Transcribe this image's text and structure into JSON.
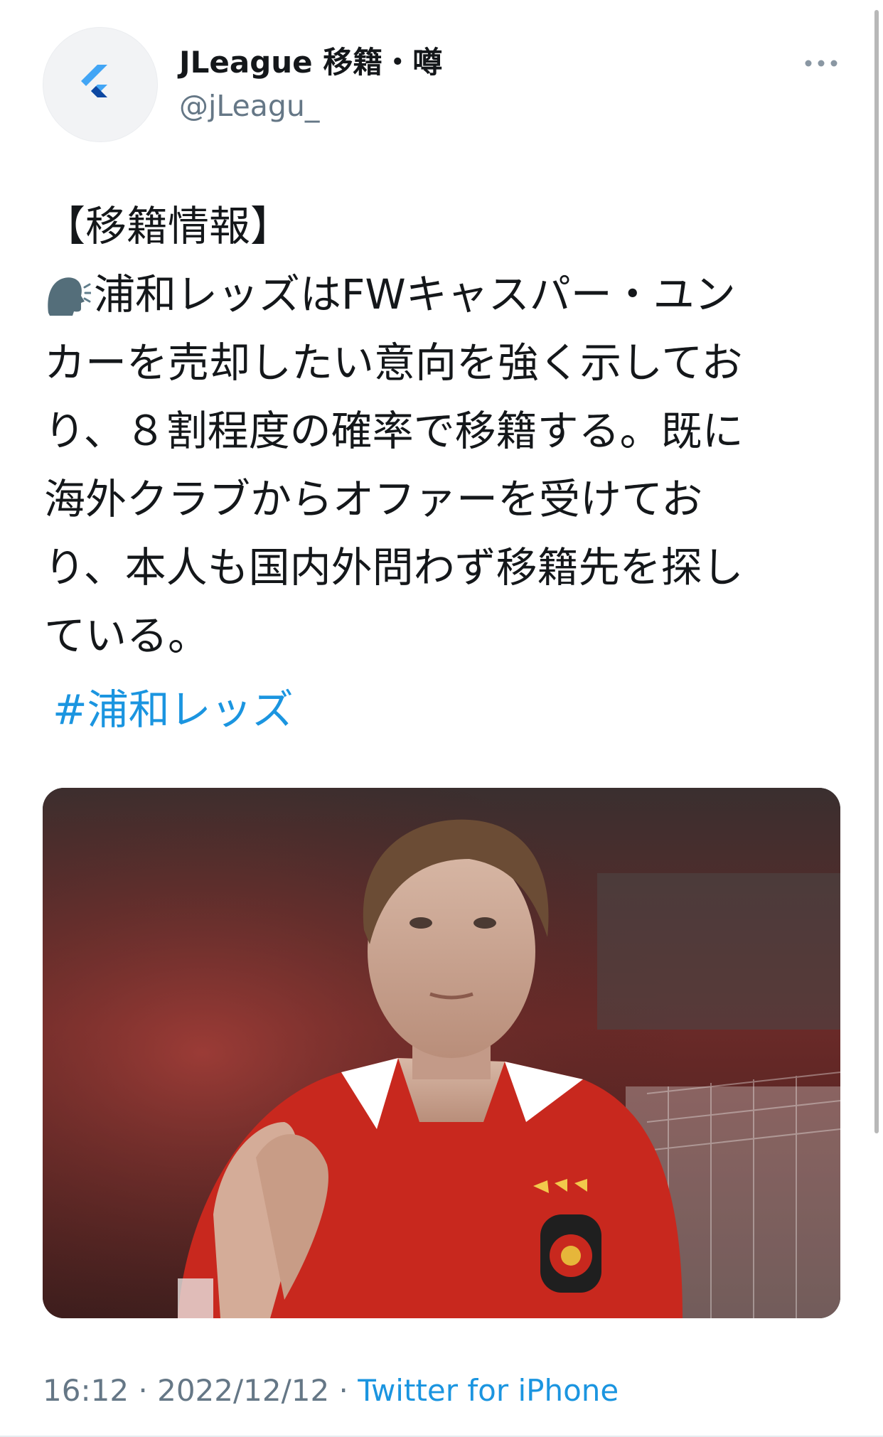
{
  "author": {
    "display_name": "JLeague 移籍・噂",
    "handle": "@jLeagu_",
    "avatar_icon": "flutter-logo-icon"
  },
  "tweet": {
    "lines": [
      "【移籍情報】",
      "浦和レッズはFWキャスパー・ユン",
      "カーを売却したい意向を強く示してお",
      "り、８割程度の確率で移籍する。既に",
      "海外クラブからオファーを受けてお",
      "り、本人も国内外問わず移籍先を探し",
      "ている。"
    ],
    "speaking_emoji": "speaking-head-icon",
    "hashtag": "#浦和レッズ"
  },
  "meta": {
    "time": "16:12",
    "separator": " · ",
    "date": "2022/12/12",
    "source": "Twitter for iPhone"
  },
  "colors": {
    "text": "#14171a",
    "secondary": "#657786",
    "link": "#1b95e0",
    "kit_red": "#c8281e"
  }
}
